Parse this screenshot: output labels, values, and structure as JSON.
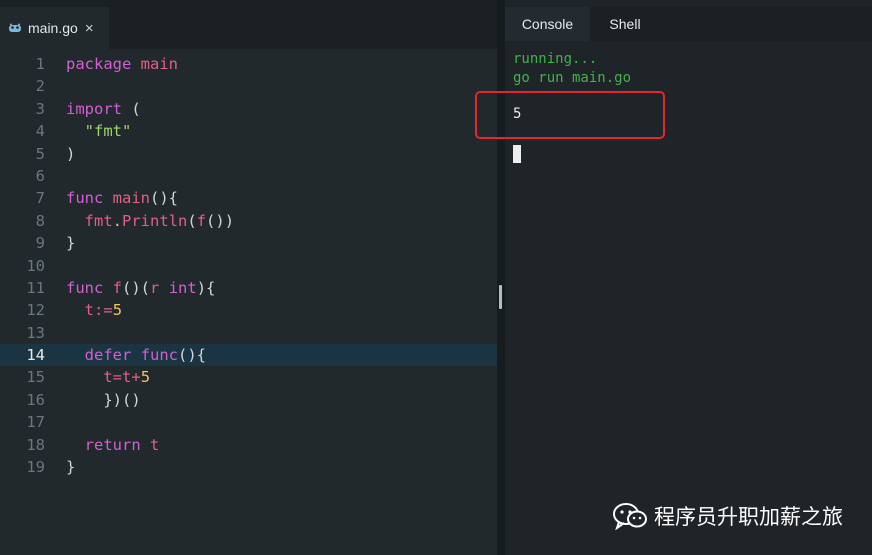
{
  "editor": {
    "tab": {
      "filename": "main.go",
      "close": "×"
    },
    "lines": [
      {
        "n": "1",
        "tokens": [
          {
            "t": "package",
            "c": "kw"
          },
          {
            "t": " ",
            "c": "pl"
          },
          {
            "t": "main",
            "c": "fn"
          }
        ]
      },
      {
        "n": "2",
        "tokens": []
      },
      {
        "n": "3",
        "tokens": [
          {
            "t": "import",
            "c": "kw"
          },
          {
            "t": " (",
            "c": "pl"
          }
        ]
      },
      {
        "n": "4",
        "tokens": [
          {
            "t": "  ",
            "c": "pl"
          },
          {
            "t": "\"fmt\"",
            "c": "str"
          }
        ]
      },
      {
        "n": "5",
        "tokens": [
          {
            "t": ")",
            "c": "pl"
          }
        ]
      },
      {
        "n": "6",
        "tokens": []
      },
      {
        "n": "7",
        "tokens": [
          {
            "t": "func",
            "c": "kw"
          },
          {
            "t": " ",
            "c": "pl"
          },
          {
            "t": "main",
            "c": "fn"
          },
          {
            "t": "(){",
            "c": "pl"
          }
        ]
      },
      {
        "n": "8",
        "tokens": [
          {
            "t": "  ",
            "c": "pl"
          },
          {
            "t": "fmt",
            "c": "fn"
          },
          {
            "t": ".",
            "c": "num"
          },
          {
            "t": "Println",
            "c": "fn"
          },
          {
            "t": "(",
            "c": "pl"
          },
          {
            "t": "f",
            "c": "fn"
          },
          {
            "t": "())",
            "c": "pl"
          }
        ]
      },
      {
        "n": "9",
        "tokens": [
          {
            "t": "}",
            "c": "pl"
          }
        ]
      },
      {
        "n": "10",
        "tokens": []
      },
      {
        "n": "11",
        "tokens": [
          {
            "t": "func",
            "c": "kw"
          },
          {
            "t": " ",
            "c": "pl"
          },
          {
            "t": "f",
            "c": "fn"
          },
          {
            "t": "()(",
            "c": "pl"
          },
          {
            "t": "r",
            "c": "fn"
          },
          {
            "t": " ",
            "c": "pl"
          },
          {
            "t": "int",
            "c": "kw"
          },
          {
            "t": "){",
            "c": "pl"
          }
        ]
      },
      {
        "n": "12",
        "tokens": [
          {
            "t": "  ",
            "c": "pl"
          },
          {
            "t": "t",
            "c": "fn"
          },
          {
            "t": ":=",
            "c": "op"
          },
          {
            "t": "5",
            "c": "num"
          }
        ]
      },
      {
        "n": "13",
        "tokens": []
      },
      {
        "n": "14",
        "active": true,
        "tokens": [
          {
            "t": "  ",
            "c": "pl"
          },
          {
            "t": "defer",
            "c": "kw"
          },
          {
            "t": " ",
            "c": "pl"
          },
          {
            "t": "func",
            "c": "kw"
          },
          {
            "t": "(){",
            "c": "pl"
          }
        ]
      },
      {
        "n": "15",
        "tokens": [
          {
            "t": "    ",
            "c": "pl"
          },
          {
            "t": "t",
            "c": "fn"
          },
          {
            "t": "=",
            "c": "op"
          },
          {
            "t": "t",
            "c": "fn"
          },
          {
            "t": "+",
            "c": "op"
          },
          {
            "t": "5",
            "c": "num"
          }
        ]
      },
      {
        "n": "16",
        "tokens": [
          {
            "t": "    })()",
            "c": "pl"
          }
        ]
      },
      {
        "n": "17",
        "tokens": []
      },
      {
        "n": "18",
        "tokens": [
          {
            "t": "  ",
            "c": "pl"
          },
          {
            "t": "return",
            "c": "kw"
          },
          {
            "t": " ",
            "c": "pl"
          },
          {
            "t": "t",
            "c": "fn"
          }
        ]
      },
      {
        "n": "19",
        "tokens": [
          {
            "t": "}",
            "c": "pl"
          }
        ]
      }
    ]
  },
  "console": {
    "tabs": {
      "console": "Console",
      "shell": "Shell"
    },
    "output_lines": "running...\ngo run main.go",
    "result": "5"
  },
  "watermark": {
    "text": "程序员升职加薪之旅"
  },
  "colors": {
    "keyword": "#d35fd1",
    "identifier": "#e25f86",
    "string": "#9ad66a",
    "number": "#efc55a",
    "console_green": "#41b34a",
    "highlight_box": "#e5262a"
  }
}
